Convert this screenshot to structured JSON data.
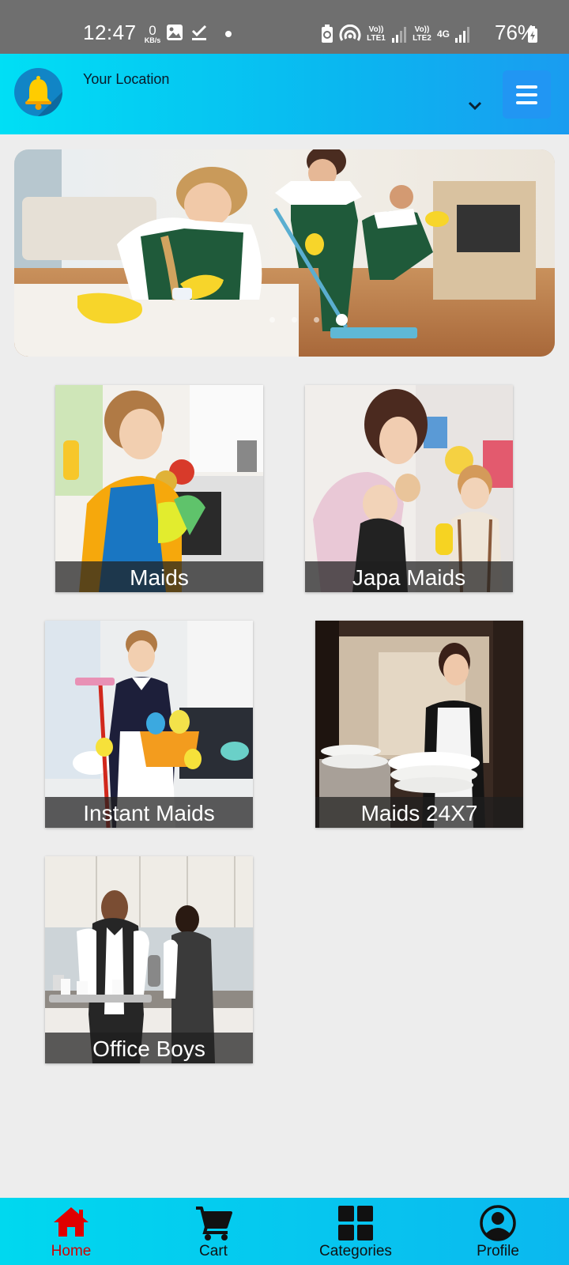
{
  "status_bar": {
    "time": "12:47",
    "speed_value": "0",
    "speed_unit": "KB/s",
    "sim1": "Vo)) LTE1",
    "sim2": "Vo)) LTE2",
    "network": "4G",
    "battery": "76%"
  },
  "header": {
    "location_label": "Your Location",
    "icons": [
      "bell-icon",
      "chevron-down-icon",
      "menu-icon"
    ],
    "accent_color": "#2196f3"
  },
  "carousel": {
    "slide_count": 4,
    "active_slide": 4
  },
  "categories": [
    {
      "label": "Maids"
    },
    {
      "label": "Japa Maids"
    },
    {
      "label": "Instant Maids"
    },
    {
      "label": "Maids 24X7"
    },
    {
      "label": "Office Boys"
    }
  ],
  "bottom_nav": {
    "items": [
      {
        "label": "Home",
        "icon": "home-icon",
        "active": true
      },
      {
        "label": "Cart",
        "icon": "cart-icon"
      },
      {
        "label": "Categories",
        "icon": "grid-icon"
      },
      {
        "label": "Profile",
        "icon": "profile-icon"
      }
    ],
    "active_color": "#d40000"
  }
}
